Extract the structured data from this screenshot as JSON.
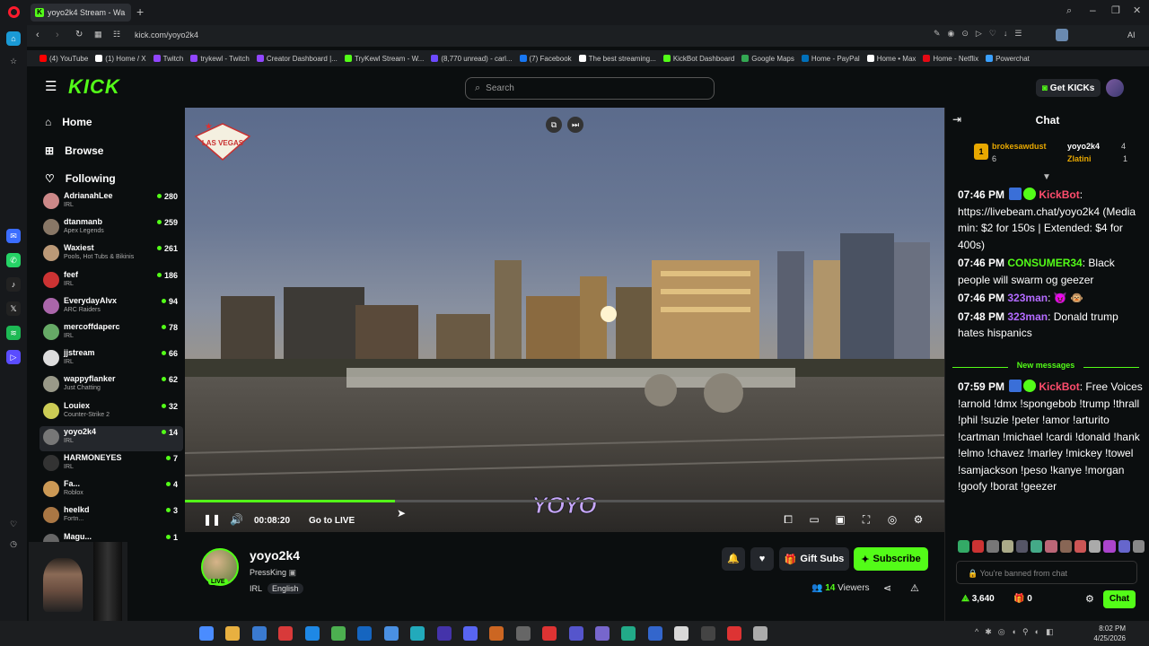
{
  "browser": {
    "tab_title": "yoyo2k4 Stream - Wa",
    "url": "kick.com/yoyo2k4",
    "bookmarks": [
      {
        "label": "(4) YouTube",
        "color": "#ff0000"
      },
      {
        "label": "(1) Home / X",
        "color": "#ffffff"
      },
      {
        "label": "Twitch",
        "color": "#9146ff"
      },
      {
        "label": "trykewl - Twitch",
        "color": "#9146ff"
      },
      {
        "label": "Creator Dashboard |...",
        "color": "#9146ff"
      },
      {
        "label": "TryKewl Stream - W...",
        "color": "#53fc18"
      },
      {
        "label": "(8,770 unread) - carl...",
        "color": "#6d4aff"
      },
      {
        "label": "(7) Facebook",
        "color": "#1877f2"
      },
      {
        "label": "The best streaming...",
        "color": "#ffffff"
      },
      {
        "label": "KickBot Dashboard",
        "color": "#53fc18"
      },
      {
        "label": "Google Maps",
        "color": "#34a853"
      },
      {
        "label": "Home - PayPal",
        "color": "#0070ba"
      },
      {
        "label": "Home • Max",
        "color": "#ffffff"
      },
      {
        "label": "Home - Netflix",
        "color": "#e50914"
      },
      {
        "label": "Powerchat",
        "color": "#3aa0ff"
      }
    ]
  },
  "header": {
    "logo": "KICK",
    "search_placeholder": "Search",
    "get_kicks": "Get KICKs"
  },
  "sidebar": {
    "nav": [
      {
        "label": "Home",
        "icon": "home-icon"
      },
      {
        "label": "Browse",
        "icon": "browse-icon"
      },
      {
        "label": "Following",
        "icon": "heart-icon"
      }
    ],
    "channels": [
      {
        "name": "AdrianahLee",
        "category": "IRL",
        "viewers": "280",
        "color": "#c88"
      },
      {
        "name": "dtanmanb",
        "category": "Apex Legends",
        "viewers": "259",
        "color": "#876"
      },
      {
        "name": "Waxiest",
        "category": "Pools, Hot Tubs & Bikinis",
        "viewers": "261",
        "color": "#b97"
      },
      {
        "name": "feef",
        "category": "IRL",
        "viewers": "186",
        "color": "#c33"
      },
      {
        "name": "EverydayAlvx",
        "category": "ARC Raiders",
        "viewers": "94",
        "color": "#a6a"
      },
      {
        "name": "mercoffdaperc",
        "category": "IRL",
        "viewers": "78",
        "color": "#6a6"
      },
      {
        "name": "jjstream",
        "category": "IRL",
        "viewers": "66",
        "color": "#ddd"
      },
      {
        "name": "wappyflanker",
        "category": "Just Chatting",
        "viewers": "62",
        "color": "#998"
      },
      {
        "name": "Louiex",
        "category": "Counter-Strike 2",
        "viewers": "32",
        "color": "#cc5"
      },
      {
        "name": "yoyo2k4",
        "category": "IRL",
        "viewers": "14",
        "color": "#777"
      },
      {
        "name": "HARMONEYES",
        "category": "IRL",
        "viewers": "7",
        "color": "#333"
      },
      {
        "name": "Fa...",
        "category": "Roblox",
        "viewers": "4",
        "color": "#c95"
      },
      {
        "name": "heelkd",
        "category": "Fortn...",
        "viewers": "3",
        "color": "#a74"
      },
      {
        "name": "Magu...",
        "category": "God of...",
        "viewers": "1",
        "color": "#666"
      }
    ]
  },
  "player": {
    "time": "00:08:20",
    "go_live": "Go to LIVE",
    "progress": 0.277,
    "overlay_text": "YOYO",
    "sign_text": "LAS VEGAS"
  },
  "stream": {
    "name": "yoyo2k4",
    "title": "PressKing",
    "live_badge": "LIVE",
    "tags": [
      "IRL",
      "English"
    ],
    "gift_subs": "Gift Subs",
    "subscribe": "Subscribe",
    "viewers_count": "14",
    "viewers_label": "Viewers"
  },
  "chat": {
    "title": "Chat",
    "leaderboard": {
      "first": {
        "rank": "1",
        "name": "brokesawdust",
        "count": "6"
      },
      "second": {
        "name": "yoyo2k4",
        "count": "4"
      },
      "third": {
        "name": "Zlatini",
        "count": "1"
      }
    },
    "messages": [
      {
        "time": "07:46 PM",
        "user": "KickBot",
        "user_color": "#ff4d6d",
        "text": "https://livebeam.chat/yoyo2k4 (Media min: $2 for 150s | Extended: $4 for 400s)"
      },
      {
        "time": "07:46 PM",
        "user": "CONSUMER34",
        "user_color": "#53fc18",
        "text": "Black people will swarm og geezer"
      },
      {
        "time": "07:46 PM",
        "user": "323man",
        "user_color": "#b36bff",
        "text": "😈 🐵"
      },
      {
        "time": "07:48 PM",
        "user": "323man",
        "user_color": "#b36bff",
        "text": "Donald trump hates hispanics"
      }
    ],
    "new_messages_label": "New messages",
    "new_messages": [
      {
        "time": "07:59 PM",
        "user": "KickBot",
        "user_color": "#ff4d6d",
        "text": "Free Voices !arnold !dmx !spongebob !trump !thrall !phil !suzie !peter !amor !arturito !cartman !michael !cardi !donald !hank !elmo !chavez !marley !mickey !towel !samjackson !peso !kanye !morgan !goofy !borat !geezer"
      }
    ],
    "banned_text": "You're banned from chat",
    "points": "3,640",
    "gifts": "0",
    "chat_button": "Chat"
  },
  "taskbar": {
    "time": "8:02 PM",
    "date": "4/25/2026"
  }
}
